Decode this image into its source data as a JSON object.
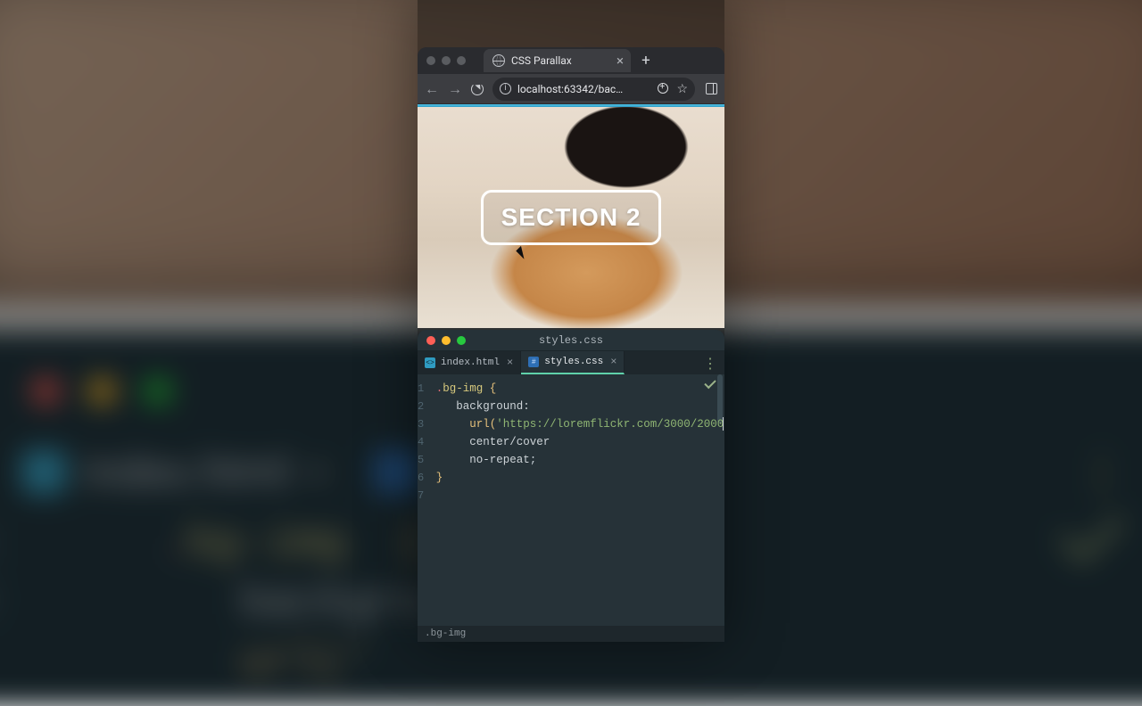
{
  "browser": {
    "tab_title": "CSS Parallax",
    "url_display": "localhost:63342/bac…",
    "hero_heading": "SECTION 2"
  },
  "editor": {
    "title": "styles.css",
    "tabs": [
      {
        "label": "index.html",
        "active": false
      },
      {
        "label": "styles.css",
        "active": true
      }
    ],
    "footer_path": ".bg-img",
    "css": {
      "selector_dot": ".",
      "selector_name": "bg-img",
      "open_brace": "{",
      "prop_background": "background",
      "colon": ":",
      "url_fn": "url",
      "url_open": "(",
      "url_q1": "'",
      "url_value": "https://loremflickr.com/3000/2000",
      "url_close": ")",
      "pos_size": "center/cover",
      "repeat": "no-repeat",
      "semi": ";",
      "close_brace": "}"
    },
    "line_numbers": [
      "1",
      "2",
      "3",
      "4",
      "5",
      "6",
      "7"
    ]
  },
  "backdrop": {
    "tab_label": "index.html",
    "code_preview": {
      "l1_num": "1",
      "l1_sel": "bg-img",
      "l1_brace": "{",
      "l2_num": "2",
      "l2_text": "backgro",
      "l3_text": "url('",
      "l3_tail": "/3000/2000')"
    }
  }
}
